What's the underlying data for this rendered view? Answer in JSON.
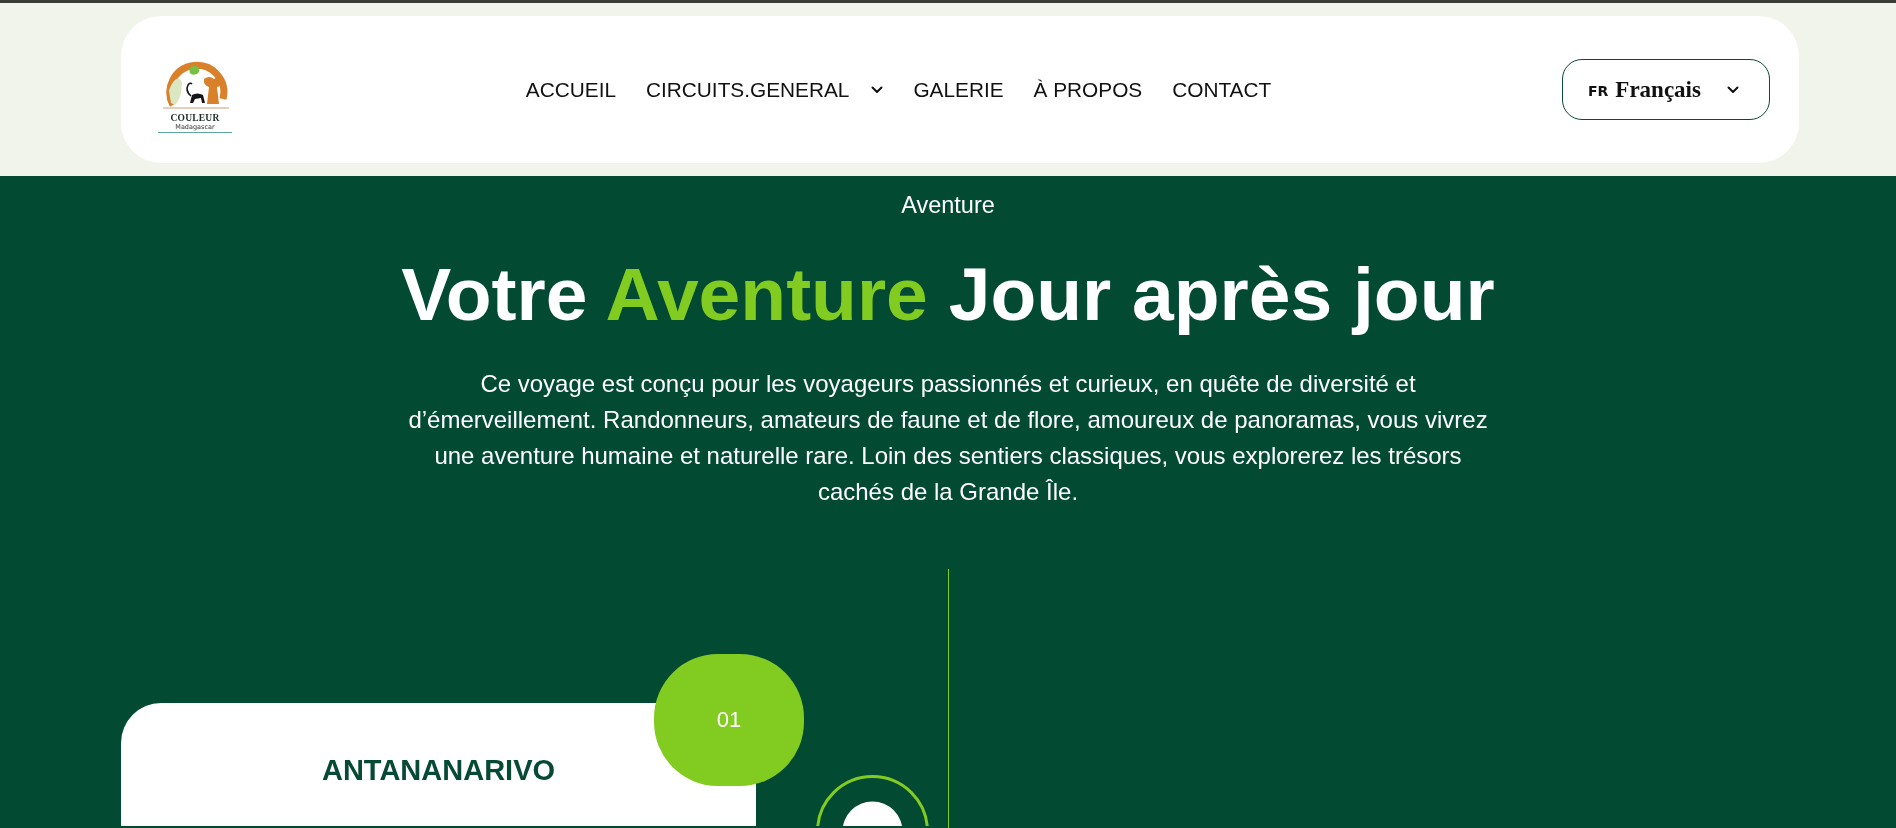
{
  "header": {
    "logo": {
      "title": "COULEUR",
      "subtitle": "Madagascar"
    },
    "nav": [
      {
        "label": "ACCUEIL",
        "kind": "link"
      },
      {
        "label": "CIRCUITS.GENERAL",
        "kind": "dropdown"
      },
      {
        "label": "GALERIE",
        "kind": "link"
      },
      {
        "label": "À PROPOS",
        "kind": "link"
      },
      {
        "label": "CONTACT",
        "kind": "link"
      }
    ],
    "language": {
      "code": "FR",
      "label": "Français"
    }
  },
  "hero": {
    "eyebrow": "Aventure",
    "title": {
      "before": "Votre",
      "highlight": "Aventure",
      "after": "Jour après jour"
    },
    "description": "Ce voyage est conçu pour les voyageurs passionnés et curieux, en quête de diversité et d’émerveillement. Randonneurs, amateurs de faune et de flore, amoureux de panoramas, vous vivrez une aventure humaine et naturelle rare. Loin des sentiers classiques, vous explorerez les trésors cachés de la Grande Île."
  },
  "timeline": {
    "steps": [
      {
        "number": "01",
        "title": "ANTANANARIVO"
      }
    ]
  }
}
